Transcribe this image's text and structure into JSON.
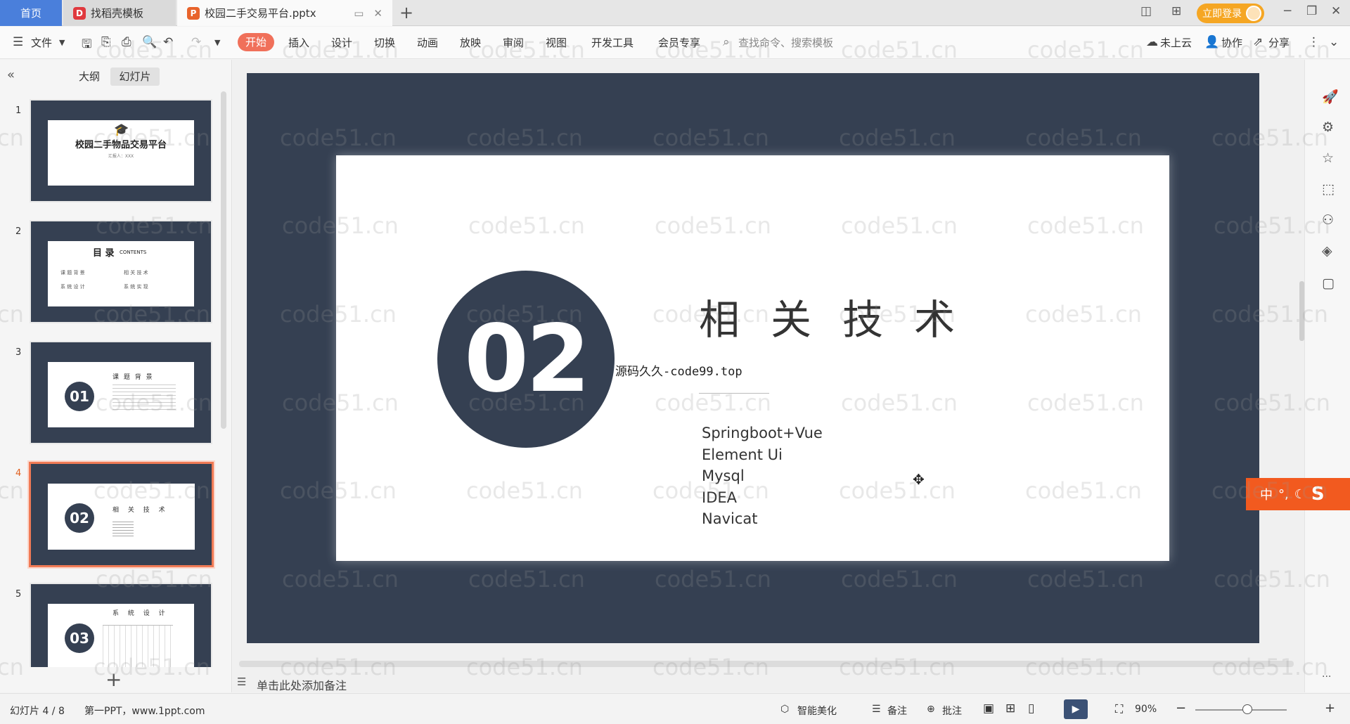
{
  "tabs": {
    "home": "首页",
    "template": "找稻壳模板",
    "document": "校园二手交易平台.pptx"
  },
  "login": "立即登录",
  "ribbon": {
    "file": "文件",
    "items": [
      "开始",
      "插入",
      "设计",
      "切换",
      "动画",
      "放映",
      "审阅",
      "视图",
      "开发工具",
      "会员专享"
    ],
    "search_placeholder": "查找命令、搜索模板",
    "cloud": "未上云",
    "collab": "协作",
    "share": "分享"
  },
  "left_panel": {
    "outline_tab": "大纲",
    "slides_tab": "幻灯片",
    "thumbnails": [
      {
        "num": "1",
        "title": "校园二手物品交易平台",
        "sub": "汇报人：XXX"
      },
      {
        "num": "2",
        "title": "目 录",
        "title_en": "CONTENTS",
        "items": [
          "课 题 背 景",
          "相 关 技 术",
          "系 统 设 计",
          "系 统 实 现"
        ]
      },
      {
        "num": "3",
        "badge": "01",
        "title": "课 题 背 景"
      },
      {
        "num": "4",
        "badge": "02",
        "title": "相 关 技 术"
      },
      {
        "num": "5",
        "badge": "03",
        "title": "系 统 设 计"
      }
    ]
  },
  "slide": {
    "number": "02",
    "title": "相关技术",
    "subtitle": "源码久久-code99.top",
    "techs": [
      "Springboot+Vue",
      "Element Ui",
      "Mysql",
      "IDEA",
      "Navicat"
    ]
  },
  "notes_placeholder": "单击此处添加备注",
  "ime": "中",
  "status": {
    "slide_count": "幻灯片 4 / 8",
    "theme": "第一PPT，www.1ppt.com",
    "beautify": "智能美化",
    "notes": "备注",
    "comment": "批注",
    "zoom": "90%"
  },
  "watermark": "code51.cn",
  "colors": {
    "slide_dark": "#354052",
    "accent": "#f0705a",
    "home_tab": "#4a7fdb",
    "login": "#f5a623"
  }
}
